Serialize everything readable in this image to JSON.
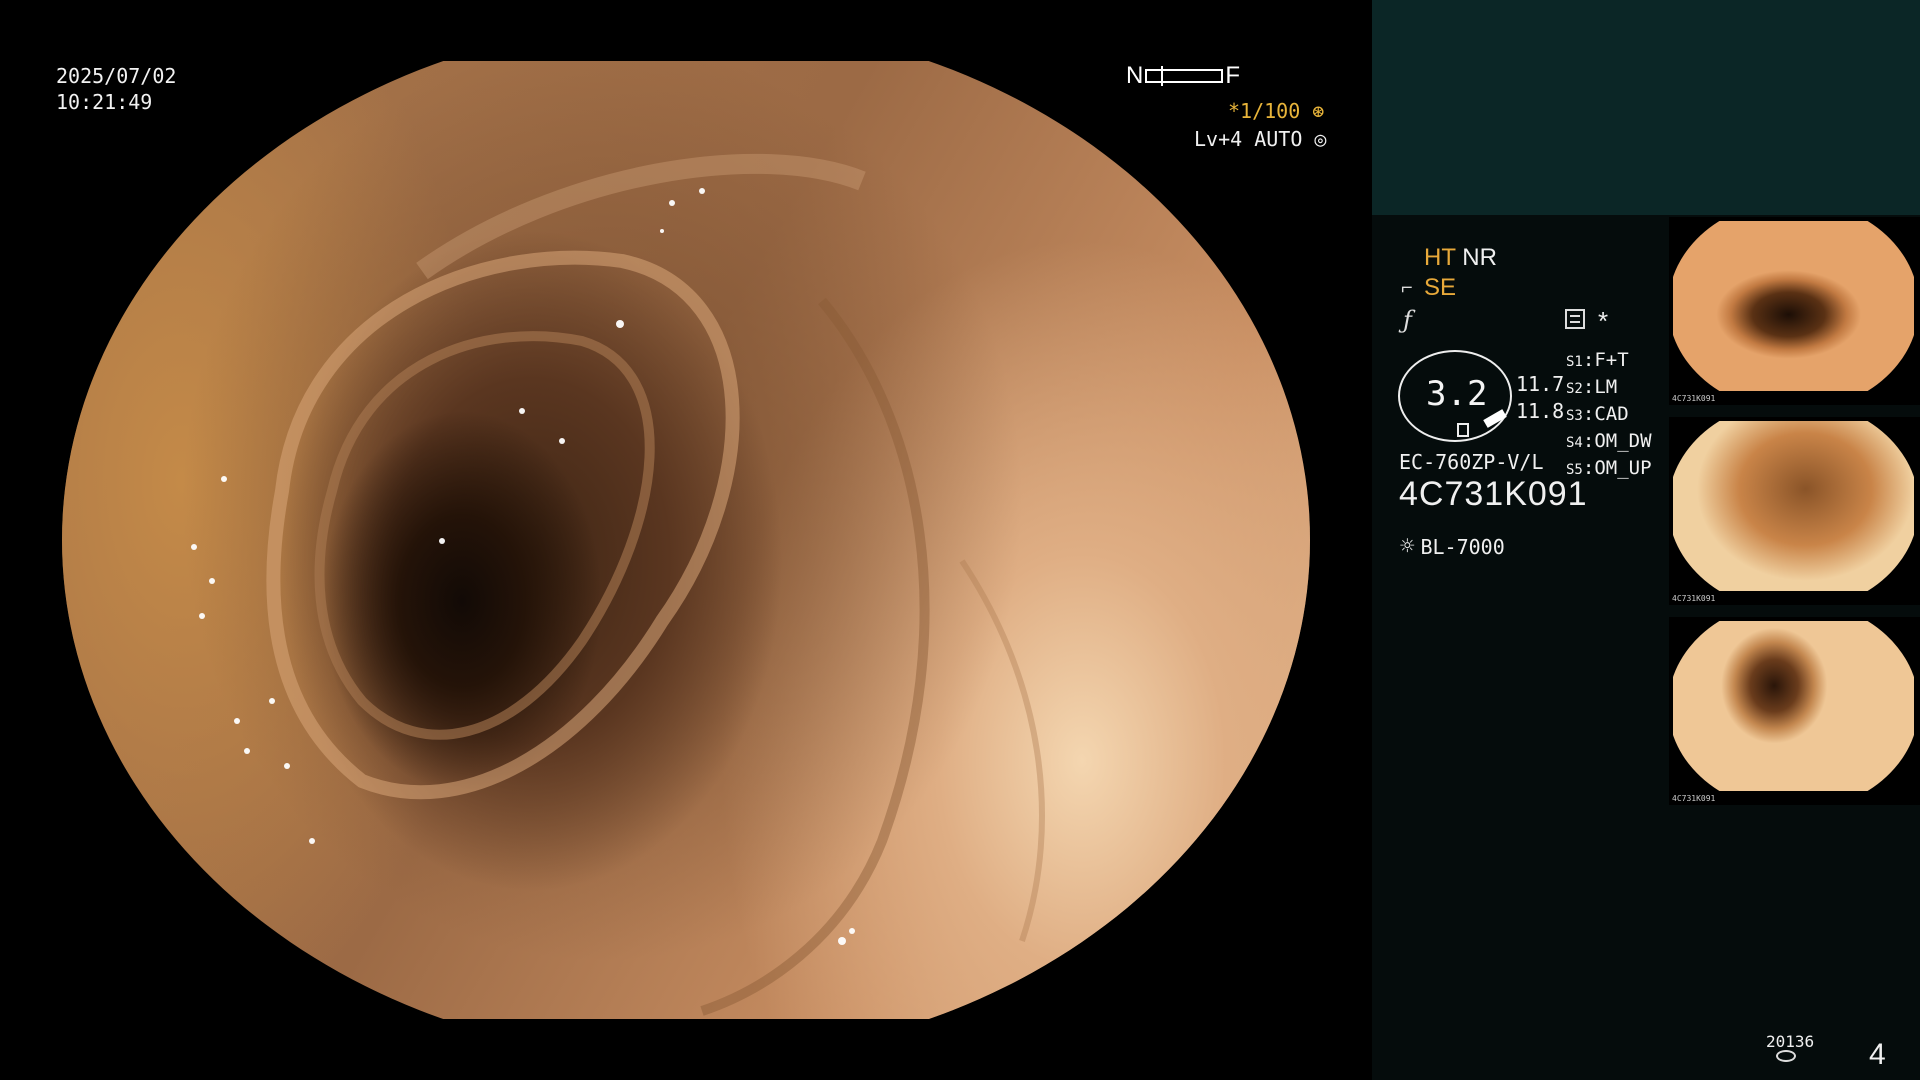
{
  "header": {
    "date": "2025/07/02",
    "time": "10:21:49",
    "focus_near": "N",
    "focus_far": "F",
    "shutter": "*1/100",
    "shutter_icon": "aperture-icon",
    "level": "Lv+4 AUTO",
    "level_icon": "target-icon"
  },
  "panel": {
    "ht": "HT",
    "nr": "NR",
    "se": "SE",
    "se_icon": "probe-icon",
    "f_icon": "ƒ",
    "star": "*",
    "gauge_value": "3.2",
    "gauge_side_1": "11.7",
    "gauge_side_2": "11.8",
    "settings": [
      {
        "key": "S1",
        "value": "F+T"
      },
      {
        "key": "S2",
        "value": "LM"
      },
      {
        "key": "S3",
        "value": "CAD"
      },
      {
        "key": "S4",
        "value": "OM_DW"
      },
      {
        "key": "S5",
        "value": "OM_UP"
      }
    ],
    "model": "EC-760ZP-V/L",
    "serial": "4C731K091",
    "light_source": "BL-7000",
    "light_icon": "sun-icon",
    "thumbnail_label": "4C731K091",
    "counter": "20136",
    "page": "4"
  },
  "colors": {
    "accent_orange": "#e8a93a",
    "panel_bg": "#050c0c",
    "panel_top_bg": "#0b2626"
  }
}
